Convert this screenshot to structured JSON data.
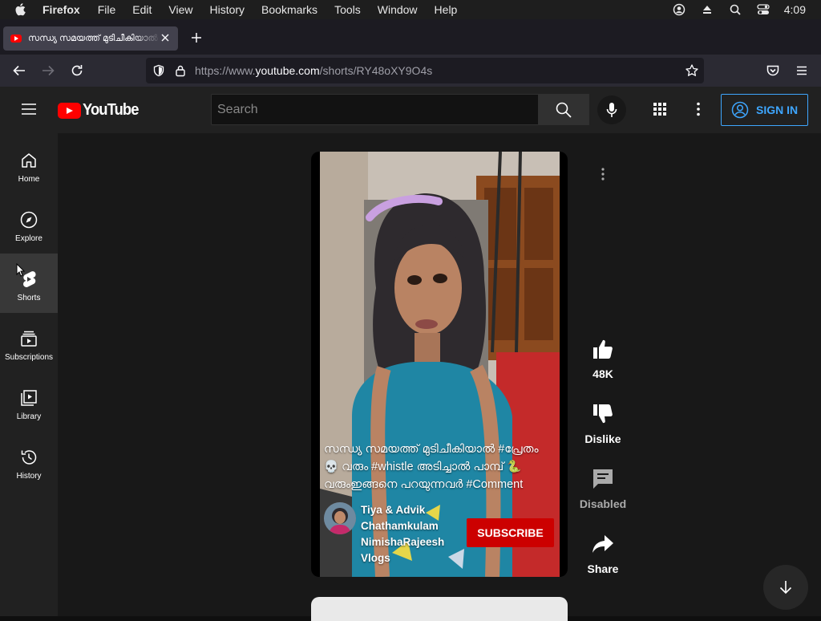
{
  "menubar": {
    "app_name": "Firefox",
    "items": [
      "File",
      "Edit",
      "View",
      "History",
      "Bookmarks",
      "Tools",
      "Window",
      "Help"
    ],
    "clock": "4:09"
  },
  "browser": {
    "tab_title": "സന്ധ്യ സമയത്ത് മുടിചീകിയാൽ #പ്രേതം",
    "url_prefix": "https://www.",
    "url_domain": "youtube.com",
    "url_path": "/shorts/RY48oXY9O4s"
  },
  "youtube": {
    "logo_text": "YouTube",
    "search_placeholder": "Search",
    "sign_in_label": "SIGN IN",
    "sidebar": [
      {
        "label": "Home",
        "icon": "home-icon"
      },
      {
        "label": "Explore",
        "icon": "compass-icon"
      },
      {
        "label": "Shorts",
        "icon": "shorts-icon",
        "active": true
      },
      {
        "label": "Subscriptions",
        "icon": "subscriptions-icon"
      },
      {
        "label": "Library",
        "icon": "library-icon"
      },
      {
        "label": "History",
        "icon": "history-icon"
      }
    ],
    "short": {
      "caption": "സന്ധ്യ സമയത്ത് മുടിചീകിയാൽ #പ്രേതം 💀 വരും #whistle അടിച്ചാൽ പാമ്പ് 🐍 വരുംഇങ്ങനെ പറയുന്നവർ #Comment",
      "channel_name": "Tiya & Advik Chathamkulam NimishaRajeesh Vlogs",
      "subscribe_label": "SUBSCRIBE"
    },
    "actions": {
      "like_count": "48K",
      "dislike_label": "Dislike",
      "comments_label": "Disabled",
      "share_label": "Share"
    }
  },
  "colors": {
    "accent_blue": "#3ea6ff",
    "subscribe_red": "#cc0000",
    "brand_red": "#ff0000"
  }
}
